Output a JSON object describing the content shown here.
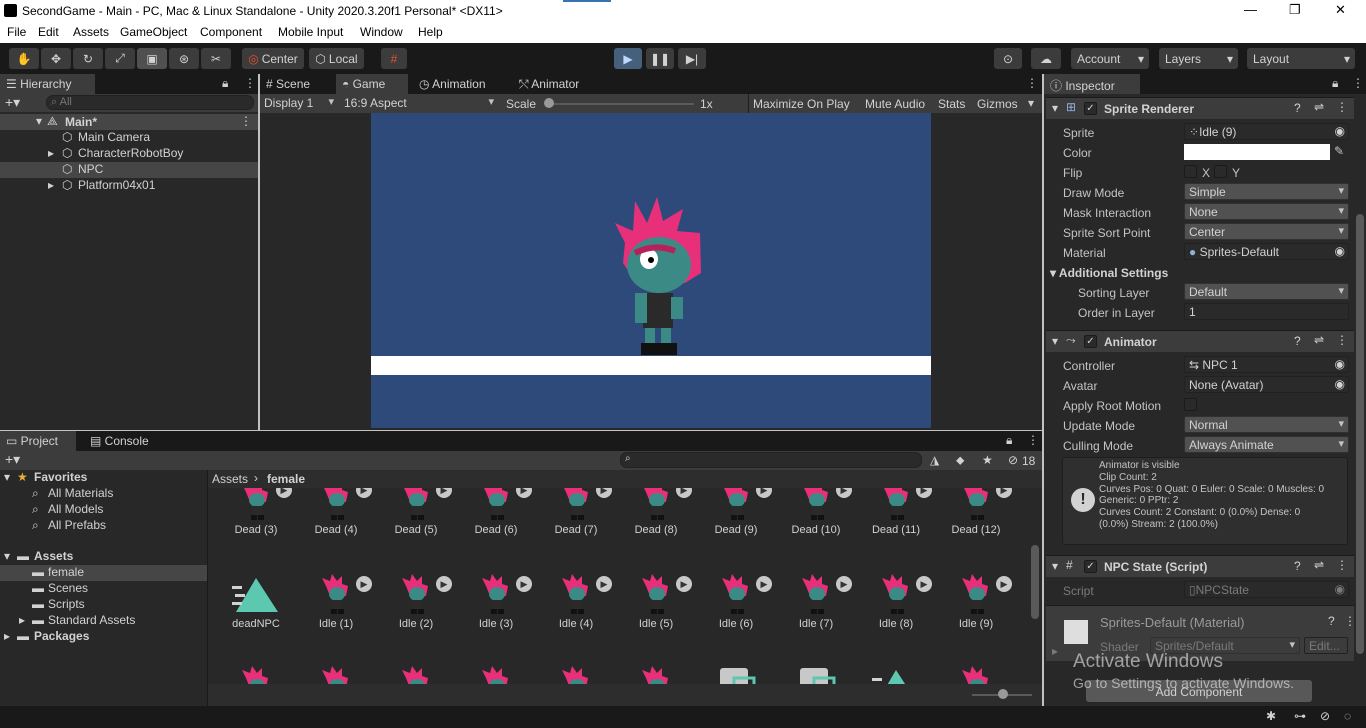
{
  "window": {
    "title": "SecondGame - Main - PC, Mac & Linux Standalone - Unity 2020.3.20f1 Personal* <DX11>",
    "min": "—",
    "max": "❐",
    "close": "✕"
  },
  "menu": [
    "File",
    "Edit",
    "Assets",
    "GameObject",
    "Component",
    "Mobile Input",
    "Window",
    "Help"
  ],
  "toolbar": {
    "center": "Center",
    "local": "Local",
    "account": "Account",
    "layers": "Layers",
    "layout": "Layout"
  },
  "hierarchy": {
    "tab": "Hierarchy",
    "search_placeholder": "All",
    "scene": "Main*",
    "items": [
      "Main Camera",
      "CharacterRobotBoy",
      "NPC",
      "Platform04x01"
    ]
  },
  "scene_tabs": [
    "Scene",
    "Game",
    "Animation",
    "Animator"
  ],
  "game_bar": {
    "display": "Display 1",
    "aspect": "16:9 Aspect",
    "scale_label": "Scale",
    "scale_value": "1x",
    "maximize": "Maximize On Play",
    "mute": "Mute Audio",
    "stats": "Stats",
    "gizmos": "Gizmos"
  },
  "colors": {
    "game_bg": "#2e4a7a",
    "platform": "#ffffff",
    "accent": "#3a72b0"
  },
  "project": {
    "tabs": [
      "Project",
      "Console"
    ],
    "breadcrumb_root": "Assets",
    "breadcrumb_current": "female",
    "hidden_count": "18",
    "tree": {
      "favorites": "Favorites",
      "fav_items": [
        "All Materials",
        "All Models",
        "All Prefabs"
      ],
      "assets": "Assets",
      "asset_items": [
        "female",
        "Scenes",
        "Scripts",
        "Standard Assets"
      ],
      "packages": "Packages"
    },
    "row1": [
      "Dead (3)",
      "Dead (4)",
      "Dead (5)",
      "Dead (6)",
      "Dead (7)",
      "Dead (8)",
      "Dead (9)",
      "Dead (10)",
      "Dead (11)",
      "Dead (12)"
    ],
    "row2": [
      "deadNPC",
      "Idle (1)",
      "Idle (2)",
      "Idle (3)",
      "Idle (4)",
      "Idle (5)",
      "Idle (6)",
      "Idle (7)",
      "Idle (8)",
      "Idle (9)"
    ]
  },
  "inspector": {
    "tab": "Inspector",
    "sprite_renderer": {
      "title": "Sprite Renderer",
      "sprite_label": "Sprite",
      "sprite": "Idle (9)",
      "color_label": "Color",
      "flip_label": "Flip",
      "flip_x": "X",
      "flip_y": "Y",
      "draw_mode_label": "Draw Mode",
      "draw_mode": "Simple",
      "mask_label": "Mask Interaction",
      "mask": "None",
      "sort_point_label": "Sprite Sort Point",
      "sort_point": "Center",
      "material_label": "Material",
      "material": "Sprites-Default",
      "additional": "Additional Settings",
      "sorting_layer_label": "Sorting Layer",
      "sorting_layer": "Default",
      "order_label": "Order in Layer",
      "order": "1"
    },
    "animator": {
      "title": "Animator",
      "controller_label": "Controller",
      "controller": "NPC 1",
      "avatar_label": "Avatar",
      "avatar": "None (Avatar)",
      "root_motion_label": "Apply Root Motion",
      "update_label": "Update Mode",
      "update": "Normal",
      "culling_label": "Culling Mode",
      "culling": "Always Animate",
      "info": [
        "Animator is visible",
        "Clip Count: 2",
        "Curves Pos: 0 Quat: 0 Euler: 0 Scale: 0 Muscles: 0",
        "Generic: 0 PPtr: 2",
        "Curves Count: 2 Constant: 0 (0.0%) Dense: 0",
        "(0.0%) Stream: 2 (100.0%)"
      ]
    },
    "npc_state": {
      "title": "NPC State (Script)",
      "script_label": "Script",
      "script": "NPCState"
    },
    "material": {
      "title": "Sprites-Default (Material)",
      "shader_label": "Shader",
      "shader": "Sprites/Default",
      "edit": "Edit..."
    },
    "add_component": "Add Component"
  },
  "watermark": {
    "line1": "Activate Windows",
    "line2": "Go to Settings to activate Windows."
  }
}
